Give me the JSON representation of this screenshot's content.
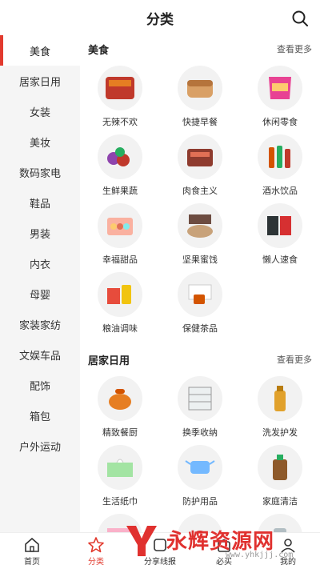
{
  "header": {
    "title": "分类",
    "search_icon": "search-icon"
  },
  "sidebar": {
    "items": [
      {
        "label": "美食",
        "active": true
      },
      {
        "label": "居家日用",
        "active": false
      },
      {
        "label": "女装",
        "active": false
      },
      {
        "label": "美妆",
        "active": false
      },
      {
        "label": "数码家电",
        "active": false
      },
      {
        "label": "鞋品",
        "active": false
      },
      {
        "label": "男装",
        "active": false
      },
      {
        "label": "内衣",
        "active": false
      },
      {
        "label": "母婴",
        "active": false
      },
      {
        "label": "家装家纺",
        "active": false
      },
      {
        "label": "文娱车品",
        "active": false
      },
      {
        "label": "配饰",
        "active": false
      },
      {
        "label": "箱包",
        "active": false
      },
      {
        "label": "户外运动",
        "active": false
      }
    ]
  },
  "sections": [
    {
      "title": "美食",
      "more": "查看更多",
      "items": [
        {
          "label": "无辣不欢",
          "icon": "spicy-meat-icon"
        },
        {
          "label": "快捷早餐",
          "icon": "bread-icon"
        },
        {
          "label": "休闲零食",
          "icon": "snack-bag-icon"
        },
        {
          "label": "生鲜果蔬",
          "icon": "fruit-icon"
        },
        {
          "label": "肉食主义",
          "icon": "meat-box-icon"
        },
        {
          "label": "酒水饮品",
          "icon": "bottles-icon"
        },
        {
          "label": "幸福甜品",
          "icon": "macaron-icon"
        },
        {
          "label": "坚果蜜饯",
          "icon": "nuts-icon"
        },
        {
          "label": "懒人速食",
          "icon": "instant-food-icon"
        },
        {
          "label": "粮油调味",
          "icon": "oil-rice-icon"
        },
        {
          "label": "保健茶品",
          "icon": "tea-icon"
        }
      ]
    },
    {
      "title": "居家日用",
      "more": "查看更多",
      "items": [
        {
          "label": "精致餐厨",
          "icon": "pot-icon"
        },
        {
          "label": "换季收纳",
          "icon": "storage-box-icon"
        },
        {
          "label": "洗发护发",
          "icon": "shampoo-icon"
        },
        {
          "label": "生活纸巾",
          "icon": "tissue-icon"
        },
        {
          "label": "防护用品",
          "icon": "mask-icon"
        },
        {
          "label": "家庭清洁",
          "icon": "cleaner-icon"
        },
        {
          "label": "",
          "icon": "towel-icon"
        },
        {
          "label": "",
          "icon": "deer-icon"
        },
        {
          "label": "",
          "icon": "jar-icon"
        }
      ]
    }
  ],
  "tabbar": {
    "tabs": [
      {
        "label": "首页",
        "icon": "home-icon",
        "active": false
      },
      {
        "label": "分类",
        "icon": "star-icon",
        "active": true
      },
      {
        "label": "分享线报",
        "icon": "share-icon",
        "active": false
      },
      {
        "label": "必买",
        "icon": "bag-icon",
        "active": false
      },
      {
        "label": "我的",
        "icon": "user-icon",
        "active": false
      }
    ]
  },
  "watermark": {
    "text": "永辉资源网",
    "url": "www.yhkjjj.com"
  },
  "colors": {
    "accent": "#e23a2e",
    "sidebar_bg": "#f5f5f5"
  }
}
